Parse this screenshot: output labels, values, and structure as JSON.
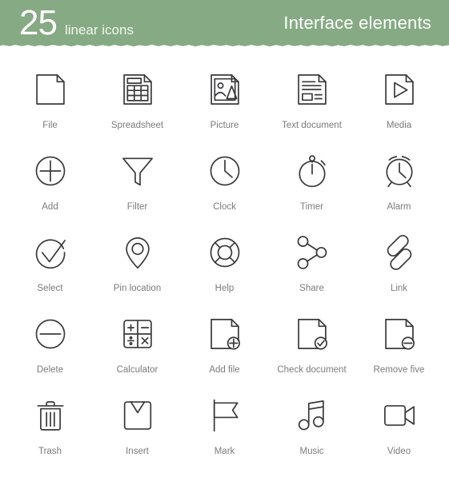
{
  "header": {
    "count": "25",
    "count_subtitle": "linear icons",
    "collection_title": "Interface elements",
    "background_color": "#86ab84",
    "text_color": "#ffffff"
  },
  "style": {
    "icon_stroke_color": "#3a3a3c",
    "caption_color": "#7b7b7b",
    "page_background": "#ffffff"
  },
  "icons": [
    {
      "label": "File",
      "icon_name": "file-icon"
    },
    {
      "label": "Spreadsheet",
      "icon_name": "spreadsheet-icon"
    },
    {
      "label": "Picture",
      "icon_name": "picture-icon"
    },
    {
      "label": "Text document",
      "icon_name": "text-document-icon"
    },
    {
      "label": "Media",
      "icon_name": "media-play-file-icon"
    },
    {
      "label": "Add",
      "icon_name": "plus-circle-icon"
    },
    {
      "label": "Filter",
      "icon_name": "filter-funnel-icon"
    },
    {
      "label": "Clock",
      "icon_name": "clock-icon"
    },
    {
      "label": "Timer",
      "icon_name": "timer-stopwatch-icon"
    },
    {
      "label": "Alarm",
      "icon_name": "alarm-clock-icon"
    },
    {
      "label": "Select",
      "icon_name": "check-circle-icon"
    },
    {
      "label": "Pin location",
      "icon_name": "map-pin-icon"
    },
    {
      "label": "Help",
      "icon_name": "lifebuoy-help-icon"
    },
    {
      "label": "Share",
      "icon_name": "share-nodes-icon"
    },
    {
      "label": "Link",
      "icon_name": "link-chain-icon"
    },
    {
      "label": "Delete",
      "icon_name": "minus-circle-icon"
    },
    {
      "label": "Calculator",
      "icon_name": "calculator-icon"
    },
    {
      "label": "Add file",
      "icon_name": "file-add-icon"
    },
    {
      "label": "Check document",
      "icon_name": "file-check-icon"
    },
    {
      "label": "Remove five",
      "icon_name": "file-remove-icon"
    },
    {
      "label": "Trash",
      "icon_name": "trash-bin-icon"
    },
    {
      "label": "Insert",
      "icon_name": "insert-box-arrow-icon"
    },
    {
      "label": "Mark",
      "icon_name": "flag-mark-icon"
    },
    {
      "label": "Music",
      "icon_name": "music-note-icon"
    },
    {
      "label": "Video",
      "icon_name": "video-camera-icon"
    }
  ]
}
